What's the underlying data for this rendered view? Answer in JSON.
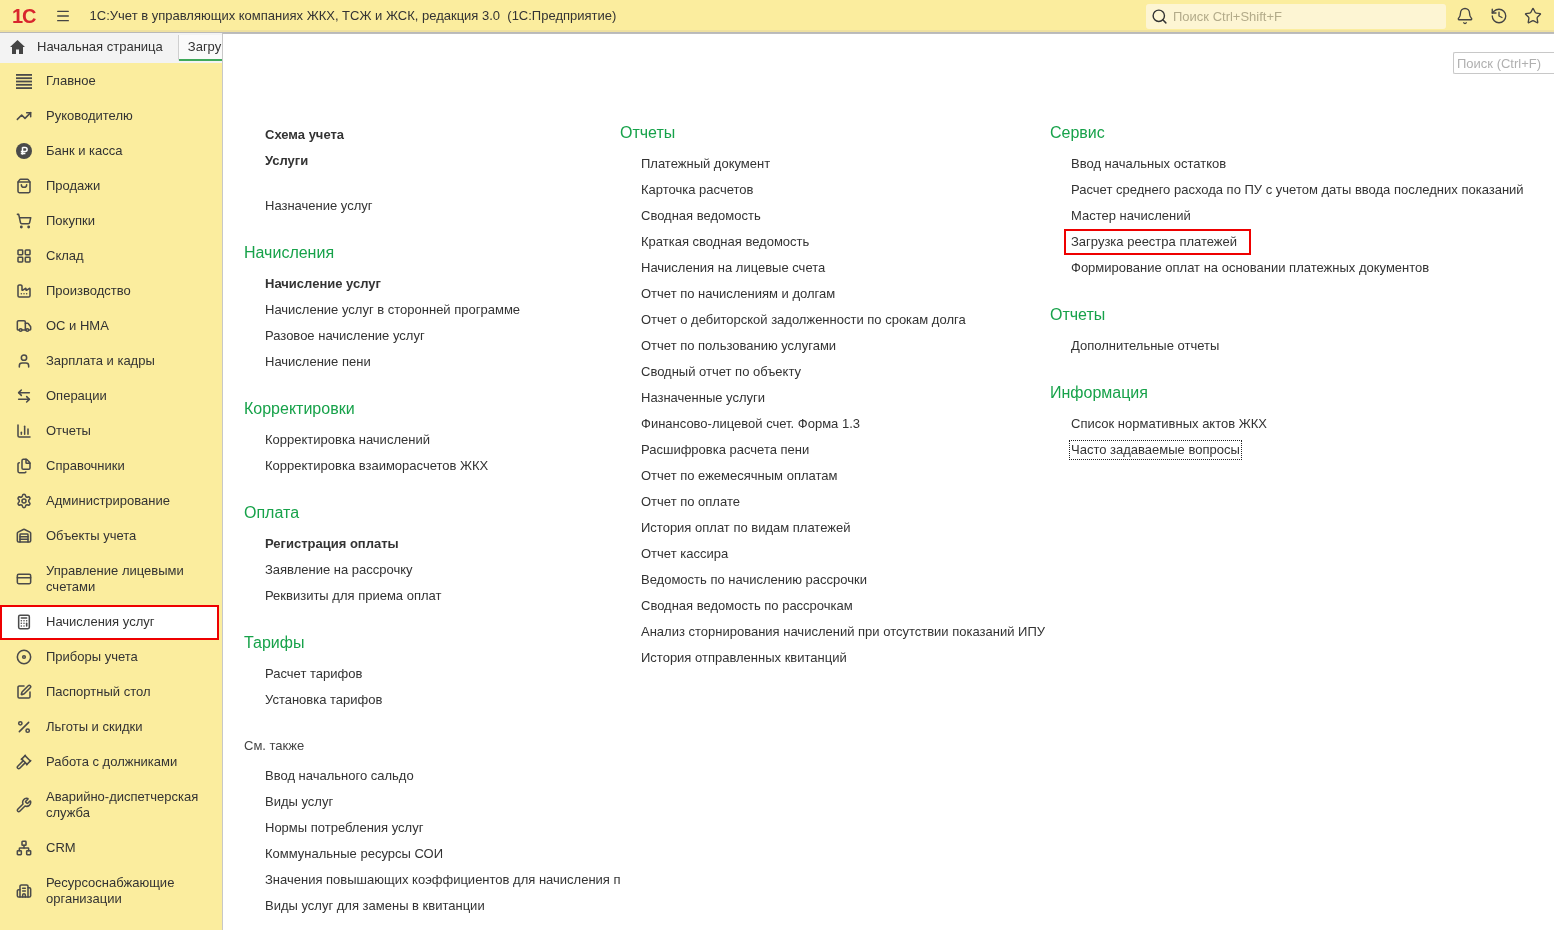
{
  "header": {
    "logo": "1С",
    "title": "1С:Учет в управляющих компаниях ЖКХ, ТСЖ и ЖСК, редакция 3.0  (1С:Предприятие)",
    "search": {
      "placeholder": "Поиск Ctrl+Shift+F"
    }
  },
  "tabs": [
    {
      "kind": "home",
      "label": "Начальная страница",
      "selected": false
    },
    {
      "kind": "document",
      "label": "Загру",
      "selected": true
    }
  ],
  "sidebar": {
    "items": [
      {
        "label": "Главное",
        "selected": false,
        "highlighted": false
      },
      {
        "label": "Руководителю",
        "selected": false,
        "highlighted": false
      },
      {
        "label": "Банк и касса",
        "selected": false,
        "highlighted": false
      },
      {
        "label": "Продажи",
        "selected": false,
        "highlighted": false
      },
      {
        "label": "Покупки",
        "selected": false,
        "highlighted": false
      },
      {
        "label": "Склад",
        "selected": false,
        "highlighted": false
      },
      {
        "label": "Производство",
        "selected": false,
        "highlighted": false
      },
      {
        "label": "ОС и НМА",
        "selected": false,
        "highlighted": false
      },
      {
        "label": "Зарплата и кадры",
        "selected": false,
        "highlighted": false
      },
      {
        "label": "Операции",
        "selected": false,
        "highlighted": false
      },
      {
        "label": "Отчеты",
        "selected": false,
        "highlighted": false
      },
      {
        "label": "Справочники",
        "selected": false,
        "highlighted": false
      },
      {
        "label": "Администрирование",
        "selected": false,
        "highlighted": false
      },
      {
        "label": "Объекты учета",
        "selected": false,
        "highlighted": false
      },
      {
        "label": "Управление лицевыми счетами",
        "selected": false,
        "highlighted": false
      },
      {
        "label": "Начисления услуг",
        "selected": true,
        "highlighted": true
      },
      {
        "label": "Приборы учета",
        "selected": false,
        "highlighted": false
      },
      {
        "label": "Паспортный стол",
        "selected": false,
        "highlighted": false
      },
      {
        "label": "Льготы и скидки",
        "selected": false,
        "highlighted": false
      },
      {
        "label": "Работа с должниками",
        "selected": false,
        "highlighted": false
      },
      {
        "label": "Аварийно-диспетчерская служба",
        "selected": false,
        "highlighted": false
      },
      {
        "label": "CRM",
        "selected": false,
        "highlighted": false
      },
      {
        "label": "Ресурсоснабжающие организации",
        "selected": false,
        "highlighted": false
      }
    ]
  },
  "content": {
    "search": {
      "placeholder": "Поиск (Ctrl+F)"
    },
    "columns": [
      {
        "groups": [
          {
            "items": [
              {
                "label": "Схема учета",
                "bold": true
              },
              {
                "label": "Услуги",
                "bold": true
              }
            ]
          },
          {
            "items": [
              {
                "label": "Назначение услуг"
              }
            ]
          },
          {
            "heading": "Начисления",
            "items": [
              {
                "label": "Начисление услуг",
                "bold": true
              },
              {
                "label": "Начисление услуг в сторонней программе",
                "bold": false
              },
              {
                "label": "Разовое начисление услуг",
                "bold": false
              },
              {
                "label": "Начисление пени",
                "bold": false
              }
            ]
          },
          {
            "heading": "Корректировки",
            "items": [
              {
                "label": "Корректировка начислений"
              },
              {
                "label": "Корректировка взаиморасчетов ЖКХ"
              }
            ]
          },
          {
            "heading": "Оплата",
            "items": [
              {
                "label": "Регистрация оплаты",
                "bold": true
              },
              {
                "label": "Заявление на рассрочку",
                "bold": false
              },
              {
                "label": "Реквизиты для приема оплат",
                "bold": false
              }
            ]
          },
          {
            "heading": "Тарифы",
            "items": [
              {
                "label": "Расчет тарифов"
              },
              {
                "label": "Установка тарифов"
              }
            ]
          }
        ],
        "see_also": {
          "title": "См. также",
          "items": [
            {
              "label": "Ввод начального сальдо"
            },
            {
              "label": "Виды услуг"
            },
            {
              "label": "Нормы потребления услуг"
            },
            {
              "label": "Коммунальные ресурсы СОИ"
            },
            {
              "label": "Значения повышающих коэффициентов для начисления п"
            },
            {
              "label": "Виды услуг для замены в квитанции"
            }
          ]
        }
      },
      {
        "groups": [
          {
            "heading": "Отчеты",
            "items": [
              {
                "label": "Платежный документ"
              },
              {
                "label": "Карточка расчетов"
              },
              {
                "label": "Сводная ведомость"
              },
              {
                "label": "Краткая сводная ведомость"
              },
              {
                "label": "Начисления на лицевые счета"
              },
              {
                "label": "Отчет по начислениям и долгам"
              },
              {
                "label": "Отчет о дебиторской задолженности по срокам долга"
              },
              {
                "label": "Отчет по пользованию услугами"
              },
              {
                "label": "Сводный отчет по объекту"
              },
              {
                "label": "Назначенные услуги"
              },
              {
                "label": "Финансово-лицевой счет. Форма 1.3"
              },
              {
                "label": "Расшифровка расчета пени"
              },
              {
                "label": "Отчет по ежемесячным оплатам"
              },
              {
                "label": "Отчет по оплате"
              },
              {
                "label": "История оплат по видам платежей"
              },
              {
                "label": "Отчет кассира"
              },
              {
                "label": "Ведомость по начислению рассрочки"
              },
              {
                "label": "Сводная ведомость по рассрочкам"
              },
              {
                "label": "Анализ сторнирования начислений при отсутствии показаний ИПУ"
              },
              {
                "label": "История отправленных квитанций"
              }
            ]
          }
        ]
      },
      {
        "groups": [
          {
            "heading": "Сервис",
            "items": [
              {
                "label": "Ввод начальных остатков",
                "highlighted": false
              },
              {
                "label": "Расчет среднего расхода по ПУ с учетом даты ввода последних показаний",
                "highlighted": false
              },
              {
                "label": "Мастер начислений",
                "highlighted": false
              },
              {
                "label": "Загрузка реестра платежей",
                "highlighted": true
              },
              {
                "label": "Формирование оплат на основании платежных документов",
                "highlighted": false
              }
            ]
          },
          {
            "heading": "Отчеты",
            "items": [
              {
                "label": "Дополнительные отчеты"
              }
            ]
          },
          {
            "heading": "Информация",
            "items": [
              {
                "label": "Список нормативных актов ЖКХ",
                "focused": false
              },
              {
                "label": "Часто задаваемые вопросы",
                "focused": true
              }
            ]
          }
        ]
      }
    ]
  }
}
